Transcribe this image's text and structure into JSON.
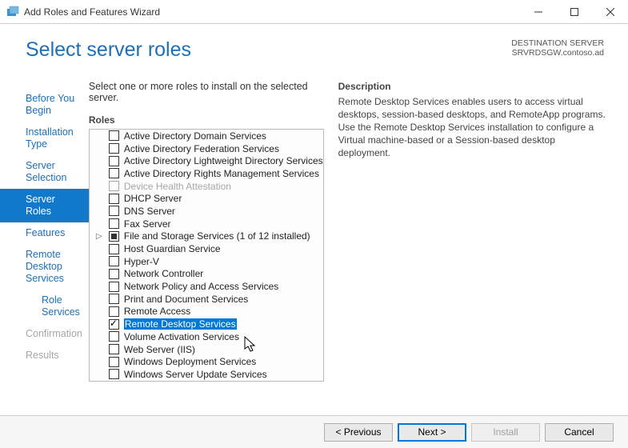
{
  "window": {
    "title": "Add Roles and Features Wizard"
  },
  "header": {
    "page_title": "Select server roles",
    "dest_label": "DESTINATION SERVER",
    "dest_server": "SRVRDSGW.contoso.ad"
  },
  "sidebar": {
    "steps": [
      {
        "label": "Before You Begin",
        "state": "normal"
      },
      {
        "label": "Installation Type",
        "state": "normal"
      },
      {
        "label": "Server Selection",
        "state": "normal"
      },
      {
        "label": "Server Roles",
        "state": "active"
      },
      {
        "label": "Features",
        "state": "normal"
      },
      {
        "label": "Remote Desktop Services",
        "state": "normal"
      },
      {
        "label": "Role Services",
        "state": "sub"
      },
      {
        "label": "Confirmation",
        "state": "disabled"
      },
      {
        "label": "Results",
        "state": "disabled"
      }
    ]
  },
  "main": {
    "instruction": "Select one or more roles to install on the selected server.",
    "roles_label": "Roles",
    "roles": [
      {
        "label": "Active Directory Domain Services",
        "checked": false
      },
      {
        "label": "Active Directory Federation Services",
        "checked": false
      },
      {
        "label": "Active Directory Lightweight Directory Services",
        "checked": false
      },
      {
        "label": "Active Directory Rights Management Services",
        "checked": false
      },
      {
        "label": "Device Health Attestation",
        "checked": false,
        "grey": true
      },
      {
        "label": "DHCP Server",
        "checked": false
      },
      {
        "label": "DNS Server",
        "checked": false
      },
      {
        "label": "Fax Server",
        "checked": false
      },
      {
        "label": "File and Storage Services (1 of 12 installed)",
        "checked": "filled",
        "expandable": true
      },
      {
        "label": "Host Guardian Service",
        "checked": false
      },
      {
        "label": "Hyper-V",
        "checked": false
      },
      {
        "label": "Network Controller",
        "checked": false
      },
      {
        "label": "Network Policy and Access Services",
        "checked": false
      },
      {
        "label": "Print and Document Services",
        "checked": false
      },
      {
        "label": "Remote Access",
        "checked": false
      },
      {
        "label": "Remote Desktop Services",
        "checked": true,
        "selected": true
      },
      {
        "label": "Volume Activation Services",
        "checked": false
      },
      {
        "label": "Web Server (IIS)",
        "checked": false
      },
      {
        "label": "Windows Deployment Services",
        "checked": false
      },
      {
        "label": "Windows Server Update Services",
        "checked": false
      }
    ],
    "desc_label": "Description",
    "desc_text": "Remote Desktop Services enables users to access virtual desktops, session-based desktops, and RemoteApp programs. Use the Remote Desktop Services installation to configure a Virtual machine-based or a Session-based desktop deployment."
  },
  "footer": {
    "previous": "< Previous",
    "next": "Next >",
    "install": "Install",
    "cancel": "Cancel"
  }
}
